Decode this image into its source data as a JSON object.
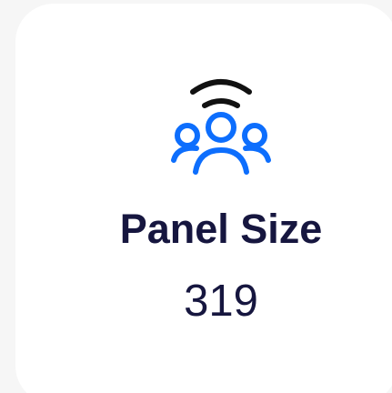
{
  "card": {
    "title": "Panel Size",
    "value": "319",
    "icon": "people-broadcast-icon"
  },
  "colors": {
    "background": "#f6f6f6",
    "card": "#ffffff",
    "text": "#16163f",
    "icon_primary": "#0d6efd",
    "icon_signal": "#111111"
  }
}
